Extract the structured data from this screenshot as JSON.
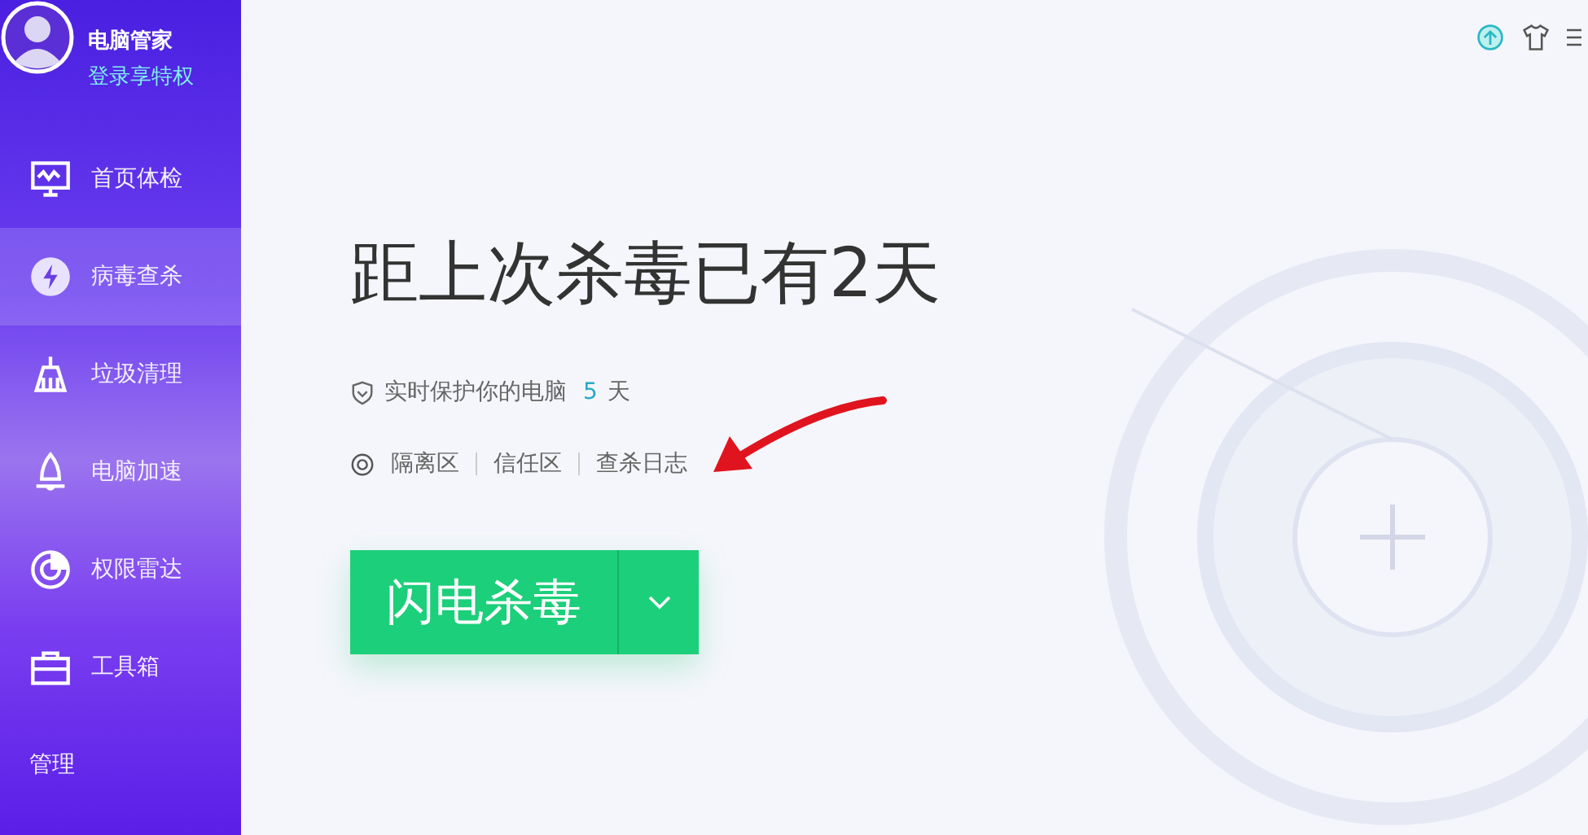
{
  "profile": {
    "name": "电脑管家",
    "login_link": "登录享特权"
  },
  "sidebar": {
    "items": [
      {
        "label": "首页体检",
        "selected": false
      },
      {
        "label": "病毒查杀",
        "selected": true
      },
      {
        "label": "垃圾清理",
        "selected": false
      },
      {
        "label": "电脑加速",
        "selected": false
      },
      {
        "label": "权限雷达",
        "selected": false
      },
      {
        "label": "工具箱",
        "selected": false
      },
      {
        "label": "管理",
        "selected": false
      }
    ]
  },
  "main": {
    "title": "距上次杀毒已有2天",
    "protection": {
      "text": "实时保护你的电脑",
      "days": "5",
      "unit": "天"
    },
    "links": [
      "隔离区",
      "信任区",
      "查杀日志"
    ],
    "scan_button": {
      "label": "闪电杀毒"
    }
  }
}
